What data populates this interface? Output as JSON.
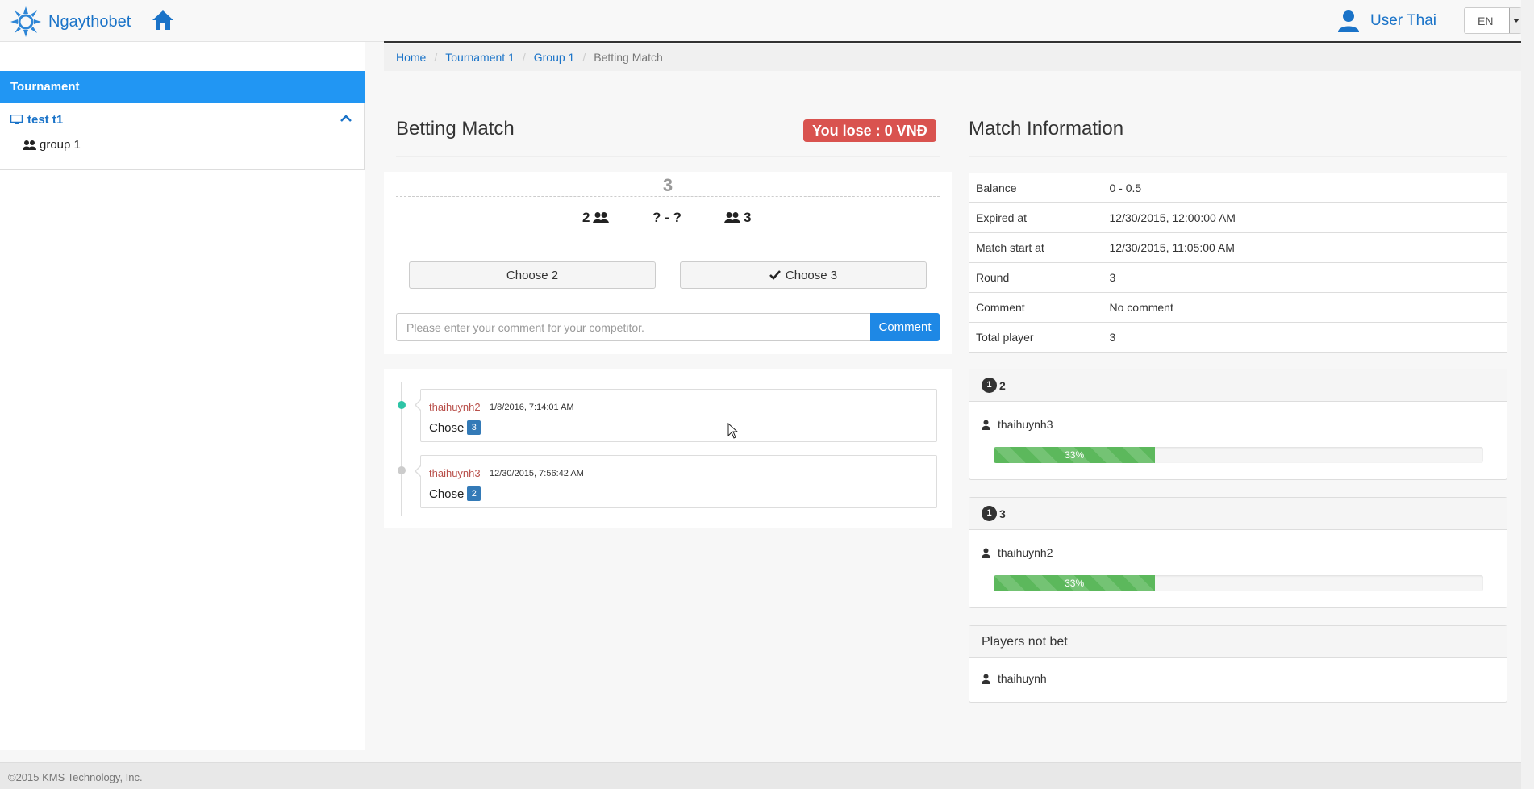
{
  "app": {
    "brand": "Ngaythobet",
    "user_name": "User Thai",
    "language": "EN"
  },
  "sidebar": {
    "header": "Tournament",
    "tree": {
      "label": "test t1",
      "children": [
        {
          "label": "group 1"
        }
      ]
    }
  },
  "breadcrumb": [
    {
      "label": "Home"
    },
    {
      "label": "Tournament 1"
    },
    {
      "label": "Group 1"
    },
    {
      "label": "Betting Match"
    }
  ],
  "betting": {
    "title": "Betting Match",
    "result_badge": "You lose : 0 VNĐ",
    "round": "3",
    "team_a": "2",
    "score": "? - ?",
    "team_b": "3",
    "choose_a_label": "Choose 2",
    "choose_b_label": "Choose 3",
    "selected_choice": "Choose 3",
    "comment_placeholder": "Please enter your comment for your competitor.",
    "comment_value": "",
    "comment_button": "Comment"
  },
  "timeline": [
    {
      "user": "thaihuynh2",
      "time": "1/8/2016, 7:14:01 AM",
      "action": "Chose",
      "choice": "3",
      "dot_color": "#2ec4a6"
    },
    {
      "user": "thaihuynh3",
      "time": "12/30/2015, 7:56:42 AM",
      "action": "Chose",
      "choice": "2",
      "dot_color": "#cccccc"
    }
  ],
  "match_info": {
    "title": "Match Information",
    "rows": [
      {
        "key": "Balance",
        "value": "0 - 0.5"
      },
      {
        "key": "Expired at",
        "value": "12/30/2015, 12:00:00 AM"
      },
      {
        "key": "Match start at",
        "value": "12/30/2015, 11:05:00 AM"
      },
      {
        "key": "Round",
        "value": "3"
      },
      {
        "key": "Comment",
        "value": "No comment"
      },
      {
        "key": "Total player",
        "value": "3"
      }
    ]
  },
  "bet_groups": [
    {
      "count": "1",
      "team": "2",
      "player": "thaihuynh3",
      "progress_label": "33%",
      "progress": 0.33
    },
    {
      "count": "1",
      "team": "3",
      "player": "thaihuynh2",
      "progress_label": "33%",
      "progress": 0.33
    }
  ],
  "players_not_bet": {
    "title": "Players not bet",
    "players": [
      "thaihuynh"
    ]
  },
  "footer": "©2015 KMS Technology, Inc.",
  "colors": {
    "brand_blue": "#1a73c8",
    "sidebar_header": "#2196f3",
    "lose_red": "#d9534f",
    "progress_green": "#5cb85c",
    "primary_button": "#1e88e5"
  }
}
